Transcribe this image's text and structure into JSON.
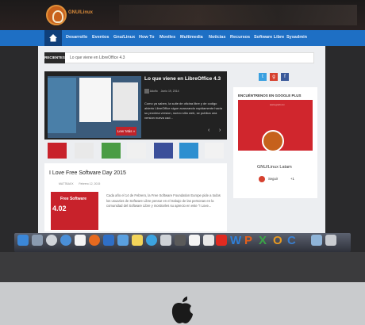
{
  "header": {
    "logo_text": "GNU/Linux"
  },
  "nav": {
    "items": [
      "Desarrollo",
      "Eventos",
      "Gnu/Linux",
      "How To",
      "Moviles",
      "Multimedia",
      "Noticias",
      "Recursos",
      "Software Libre",
      "Sysadmin"
    ]
  },
  "recent": {
    "label": "RECIENTES",
    "text": "Lo que viene en LibreOffice 4.3"
  },
  "slider": {
    "title": "Lo que viene en LibreOffice 4.3",
    "author": "Adolfo",
    "date": "Junio 19, 2014",
    "excerpt": "Como ya saben, la suite de oficina libre y de codigo abierto LibreOffice sigue avanzando rapidamente hacia su proxima version, nuevo sitio web, se publica una version nueva cad...",
    "read_more": "Leer Más »"
  },
  "post": {
    "title": "I Love Free Software Day 2015",
    "author": "MATTBAXX",
    "date": "Febrero 12, 2015",
    "image_title": "Free Software",
    "image_version": "4.02",
    "excerpt": "Cada año el 14 de Febrero, la Free Software Foundation Europe pide a todos los usuarios de Software Libre pensar en el trabajo de las personas en la comunidad del Software Libre y mostrarles su aprecio en este \"I Love..."
  },
  "widget": {
    "heading": "ENCUÉNTRENOS EN GOOGLE PLUS",
    "url": "www.gnuh.mx",
    "name": "GNU/Linux Latam",
    "follow": "Seguir",
    "count": "+1"
  },
  "colors": {
    "nav": "#1e6fc4",
    "accent": "#c0232a",
    "brand_orange": "#c8621c"
  }
}
